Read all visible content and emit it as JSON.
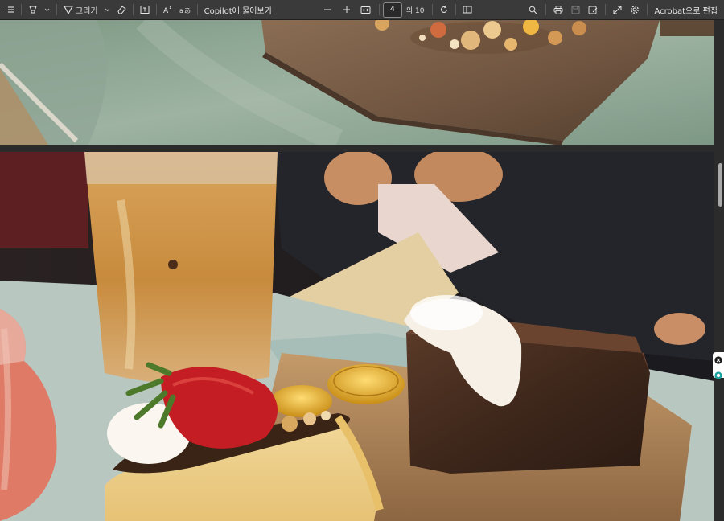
{
  "toolbar": {
    "draw_label": "그리기",
    "copilot_label": "Copilot에 물어보기",
    "page_current": "4",
    "page_total_label": "의 10",
    "acrobat_label": "Acrobat으로 편집",
    "icons": [
      "contents-icon",
      "highlight-icon",
      "draw-icon",
      "eraser-icon",
      "text-box-icon",
      "read-aloud-icon",
      "translate-icon",
      "zoom-out-icon",
      "zoom-in-icon",
      "fit-page-icon",
      "rotate-icon",
      "page-view-icon",
      "search-icon",
      "print-icon",
      "save-icon",
      "save-as-icon",
      "fullscreen-icon",
      "settings-icon"
    ]
  },
  "colors": {
    "toolbar_bg": "#3a3a3a",
    "viewer_bg": "#2b2b2b",
    "text": "#e6e6e6"
  }
}
